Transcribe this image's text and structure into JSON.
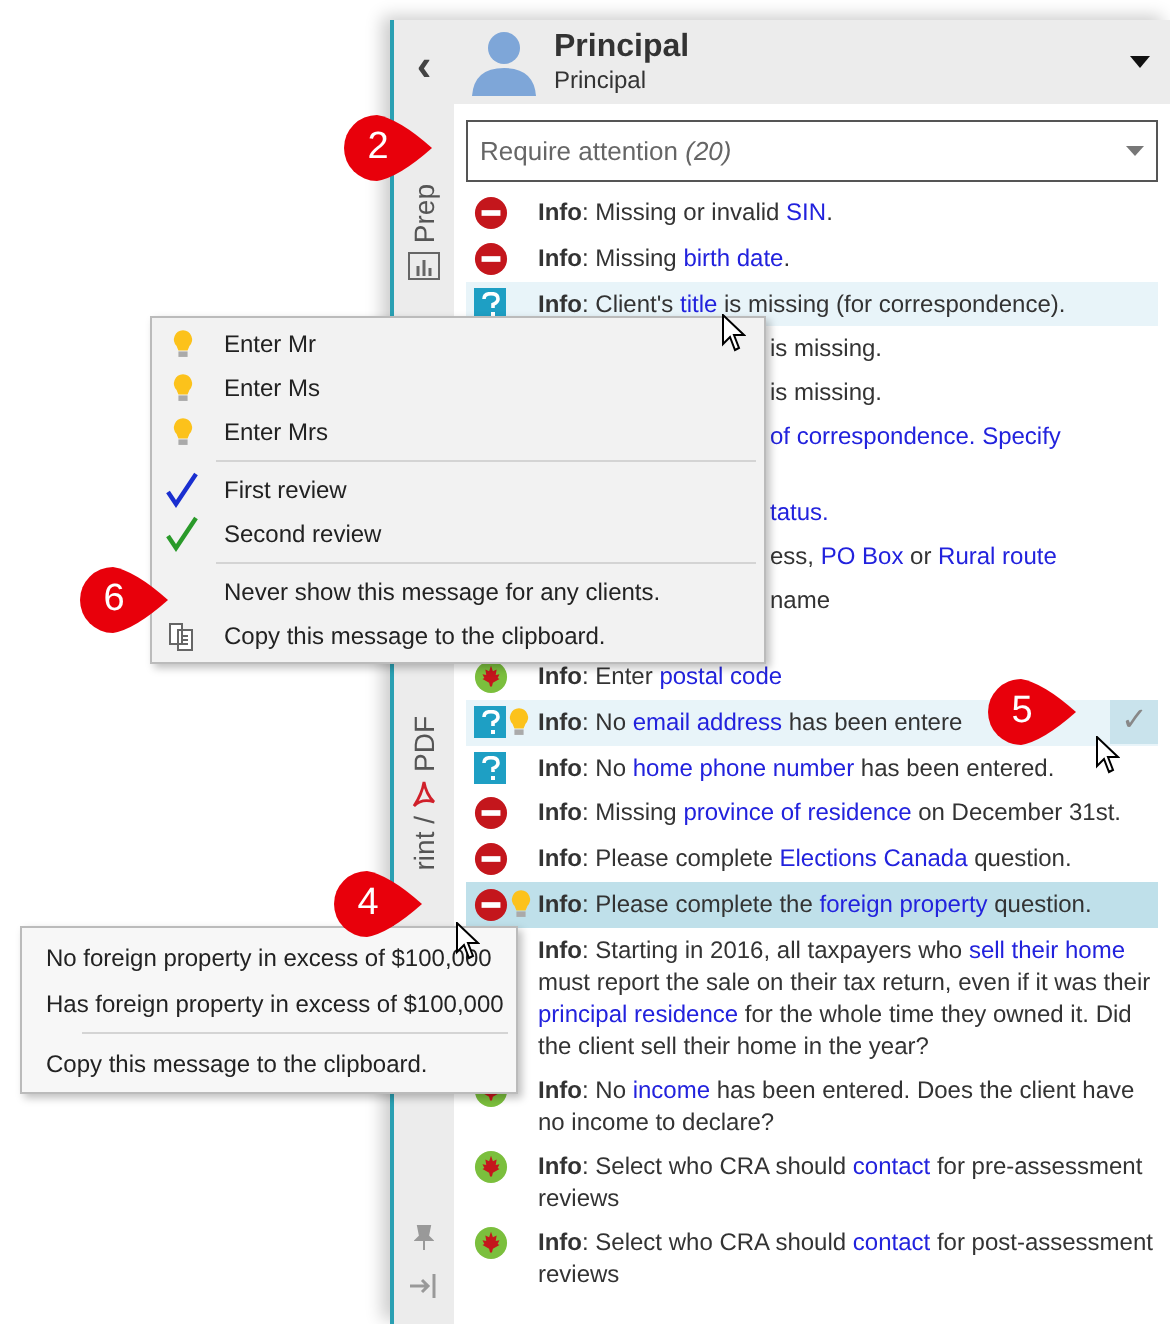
{
  "panel": {
    "back": "‹",
    "strip_tabs": [
      {
        "kind": "prep",
        "label": "Prep"
      },
      {
        "kind": "pdf",
        "label": "rint /",
        "label2": "PDF"
      }
    ],
    "header": {
      "name": "Principal",
      "subtitle": "Principal"
    },
    "filter": {
      "value": "Require attention *(20)*"
    },
    "messages": [
      {
        "kind": "full",
        "icons": [
          {
            "kind": "error"
          }
        ],
        "hovered": false,
        "selected": false,
        "parts": [
          {
            "kind": "label",
            "text": "Info"
          },
          {
            "text": ": Missing or invalid "
          },
          {
            "kind": "link",
            "text": "SIN"
          },
          {
            "text": "."
          }
        ]
      },
      {
        "kind": "full",
        "icons": [
          {
            "kind": "error"
          }
        ],
        "hovered": false,
        "selected": false,
        "parts": [
          {
            "kind": "label",
            "text": "Info"
          },
          {
            "text": ": Missing "
          },
          {
            "kind": "link",
            "text": "birth date"
          },
          {
            "text": "."
          }
        ]
      },
      {
        "kind": "full",
        "icons": [
          {
            "kind": "question"
          }
        ],
        "hovered": true,
        "selected": false,
        "parts": [
          {
            "kind": "label",
            "text": "Info"
          },
          {
            "text": ": Client's "
          },
          {
            "kind": "link",
            "text": "title"
          },
          {
            "text": " is missing (for correspondence)."
          }
        ]
      },
      {
        "kind": "partial",
        "parts": [
          {
            "text": "is missing."
          }
        ]
      },
      {
        "kind": "partial",
        "parts": [
          {
            "text": "is missing."
          }
        ]
      },
      {
        "kind": "partial",
        "parts": [
          {
            "kind": "link",
            "text": "of correspondence. Specify"
          }
        ]
      },
      {
        "kind": "covered"
      },
      {
        "kind": "partial",
        "parts": [
          {
            "kind": "link",
            "text": "tatus."
          }
        ]
      },
      {
        "kind": "partial",
        "parts": [
          {
            "text": "ess, "
          },
          {
            "kind": "link",
            "text": "PO Box"
          },
          {
            "text": " or "
          },
          {
            "kind": "link",
            "text": "Rural route"
          }
        ]
      },
      {
        "kind": "partial",
        "parts": [
          {
            "text": "name"
          }
        ]
      },
      {
        "kind": "covered"
      },
      {
        "kind": "full",
        "icons": [
          {
            "kind": "maple"
          }
        ],
        "hovered": false,
        "selected": false,
        "parts": [
          {
            "kind": "label",
            "text": "Info"
          },
          {
            "text": ": Enter "
          },
          {
            "kind": "link",
            "text": "postal code"
          }
        ]
      },
      {
        "kind": "full",
        "icons": [
          {
            "kind": "question"
          },
          {
            "kind": "bulb"
          }
        ],
        "hovered": true,
        "selected": false,
        "action": "✓",
        "parts": [
          {
            "kind": "label",
            "text": "Info"
          },
          {
            "text": ": No "
          },
          {
            "kind": "link",
            "text": "email address"
          },
          {
            "text": " has been entere"
          }
        ]
      },
      {
        "kind": "full",
        "icons": [
          {
            "kind": "question"
          }
        ],
        "hovered": false,
        "selected": false,
        "parts": [
          {
            "kind": "label",
            "text": "Info"
          },
          {
            "text": ": No "
          },
          {
            "kind": "link",
            "text": "home phone number"
          },
          {
            "text": " has been entered."
          }
        ]
      },
      {
        "kind": "full",
        "icons": [
          {
            "kind": "error"
          }
        ],
        "hovered": false,
        "selected": false,
        "parts": [
          {
            "kind": "label",
            "text": "Info"
          },
          {
            "text": ": Missing "
          },
          {
            "kind": "link",
            "text": "province of residence"
          },
          {
            "text": " on December 31st."
          }
        ]
      },
      {
        "kind": "full",
        "icons": [
          {
            "kind": "error"
          }
        ],
        "hovered": false,
        "selected": false,
        "parts": [
          {
            "kind": "label",
            "text": "Info"
          },
          {
            "text": ": Please complete "
          },
          {
            "kind": "link",
            "text": "Elections Canada"
          },
          {
            "text": " question."
          }
        ]
      },
      {
        "kind": "full",
        "icons": [
          {
            "kind": "error"
          },
          {
            "kind": "bulb"
          }
        ],
        "selected": true,
        "parts": [
          {
            "kind": "label",
            "text": "Info"
          },
          {
            "text": ": Please complete the "
          },
          {
            "kind": "link",
            "text": "foreign property"
          },
          {
            "text": " question."
          }
        ]
      },
      {
        "kind": "full",
        "hovered": false,
        "selected": false,
        "parts": [
          {
            "kind": "label",
            "text": "Info"
          },
          {
            "text": ": Starting in 2016, all taxpayers who "
          },
          {
            "kind": "link",
            "text": "sell their home"
          },
          {
            "text": " must report the sale on their tax return, even if it was their "
          },
          {
            "kind": "link",
            "text": "principal residence"
          },
          {
            "text": " for the whole time they owned it. Did the client sell their home in the year?"
          }
        ]
      },
      {
        "kind": "full",
        "icons": [
          {
            "kind": "maple"
          }
        ],
        "hovered": false,
        "selected": false,
        "parts": [
          {
            "kind": "label",
            "text": "Info"
          },
          {
            "text": ": No "
          },
          {
            "kind": "link",
            "text": "income"
          },
          {
            "text": " has been entered. Does the client have no income to declare?"
          }
        ]
      },
      {
        "kind": "full",
        "icons": [
          {
            "kind": "maple"
          }
        ],
        "hovered": false,
        "selected": false,
        "parts": [
          {
            "kind": "label",
            "text": "Info"
          },
          {
            "text": ": Select who CRA should "
          },
          {
            "kind": "link",
            "text": "contact"
          },
          {
            "text": " for pre-assessment reviews"
          }
        ]
      },
      {
        "kind": "full",
        "icons": [
          {
            "kind": "maple"
          }
        ],
        "hovered": false,
        "selected": false,
        "parts": [
          {
            "kind": "label",
            "text": "Info"
          },
          {
            "text": ": Select who CRA should "
          },
          {
            "kind": "link",
            "text": "contact"
          },
          {
            "text": " for post-assessment reviews"
          }
        ]
      }
    ]
  },
  "title_menu": [
    {
      "kind": "bulb",
      "label": "Enter Mr"
    },
    {
      "kind": "bulb",
      "label": "Enter Ms"
    },
    {
      "kind": "bulb",
      "label": "Enter Mrs"
    },
    {
      "kind": "separator"
    },
    {
      "kind": "check",
      "label": "First review",
      "color": "#1a2fd0"
    },
    {
      "kind": "check",
      "label": "Second review",
      "color": "#2a9a2a"
    },
    {
      "kind": "separator"
    },
    {
      "kind": "none",
      "label": "Never show this message for any clients."
    },
    {
      "kind": "copy",
      "label": "Copy this message to the clipboard."
    }
  ],
  "property_menu": [
    {
      "kind": "none",
      "label": "No foreign property in excess of $100,000"
    },
    {
      "kind": "none",
      "label": "Has foreign property in excess of $100,000"
    },
    {
      "kind": "separator"
    },
    {
      "kind": "none",
      "label": "Copy this message to the clipboard."
    }
  ],
  "callouts": [
    {
      "number": "2"
    },
    {
      "number": "6"
    },
    {
      "number": "4"
    },
    {
      "number": "5"
    }
  ]
}
